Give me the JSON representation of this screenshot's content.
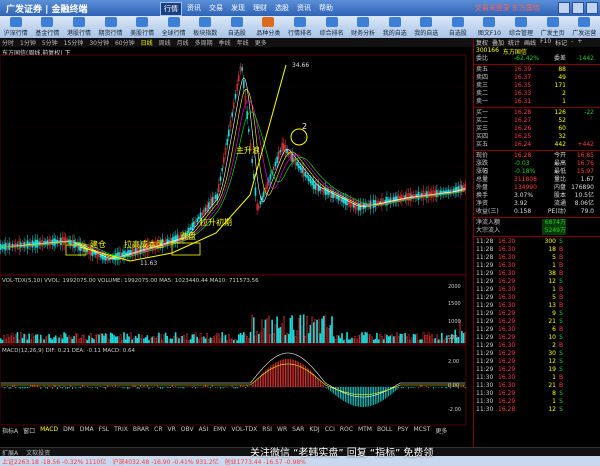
{
  "window": {
    "app_name": "广发证券 | 金融终端",
    "menu": [
      "行情",
      "资讯",
      "交易",
      "发现",
      "理财",
      "选股",
      "资讯",
      "帮助"
    ],
    "active_menu": 0,
    "top_right_text": "交易未登录   东方国信"
  },
  "toolbar": {
    "items": [
      "沪深行情",
      "基金行情",
      "港股行情",
      "期货行情",
      "美股行情",
      "全球行情",
      "板块指数",
      "自选股",
      "品种分类",
      "行情排名",
      "综合排名",
      "财务分析",
      "我的自选",
      "我的自选",
      "自选股",
      "图文F10",
      "综合管理",
      "广发主页",
      "广发运营"
    ]
  },
  "period_tabs": {
    "items": [
      "分时",
      "1分钟",
      "5分钟",
      "15分钟",
      "30分钟",
      "60分钟",
      "日线",
      "周线",
      "月线",
      "多周期",
      "季线",
      "年线",
      "更多"
    ],
    "active": 6
  },
  "chart_header": {
    "stock_title": "东方国信(周线,前复权) 下",
    "peak_label": "34.66",
    "low_label": "11.63"
  },
  "annotations": {
    "jian_cang": "建仓",
    "la_gao": "拉高成本区",
    "xi_pan": "洗盘",
    "la_sheng": "拉升初期",
    "zhu_sheng": "主升浪",
    "mark2": "2"
  },
  "vol_pane": {
    "label": "VOL-TDX(5,10) VVOL: 1992075.00  VOLUME: 1992075.00  MA5: 1023440.44  MA10: 711573.56",
    "ticks": [
      "2000",
      "1500",
      "1000",
      "500"
    ]
  },
  "macd_pane": {
    "label": "MACD(12,26,9) DIF: 0.21  DEA: -0.11  MACD: 0.64",
    "ticks": [
      "2.00",
      "0.00",
      "-2.00"
    ]
  },
  "indicator_tabs": {
    "items": [
      "指标A",
      "窗口",
      "MACD",
      "DMI",
      "DMA",
      "FSL",
      "TRIX",
      "BRAR",
      "CR",
      "VR",
      "OBV",
      "ASI",
      "EMV",
      "VOL-TDX",
      "RSI",
      "WR",
      "SAR",
      "KDJ",
      "CCI",
      "ROC",
      "MTM",
      "BOLL",
      "PSY",
      "MCST",
      "更多"
    ],
    "active": 2
  },
  "bottom_tabs": [
    "扩展A",
    "文软投资"
  ],
  "quote": {
    "header": [
      "复权",
      "叠加",
      "统计",
      "画线",
      "F10",
      "标记",
      "-",
      "+"
    ],
    "code": "300166",
    "name": "东方国信",
    "weibi": {
      "label": "委比",
      "value": "-62.42%",
      "label2": "委差",
      "value2": "-1442"
    },
    "sells": [
      {
        "name": "卖五",
        "price": "16.39",
        "vol": "88"
      },
      {
        "name": "卖四",
        "price": "16.37",
        "vol": "49"
      },
      {
        "name": "卖三",
        "price": "16.35",
        "vol": "171"
      },
      {
        "name": "卖二",
        "price": "16.33",
        "vol": "2"
      },
      {
        "name": "卖一",
        "price": "16.31",
        "vol": "1"
      }
    ],
    "buys": [
      {
        "name": "买一",
        "price": "16.28",
        "vol": "126",
        "chg": "-22"
      },
      {
        "name": "买二",
        "price": "16.27",
        "vol": "52",
        "chg": ""
      },
      {
        "name": "买三",
        "price": "16.26",
        "vol": "60",
        "chg": ""
      },
      {
        "name": "买四",
        "price": "16.25",
        "vol": "32",
        "chg": ""
      },
      {
        "name": "买五",
        "price": "16.24",
        "vol": "442",
        "chg": "+442"
      }
    ],
    "stats": [
      {
        "l1": "现价",
        "v1": "16.28",
        "l2": "今开",
        "v2": "16.85"
      },
      {
        "l1": "涨跌",
        "v1": "-0.03",
        "l2": "最高",
        "v2": "16.76"
      },
      {
        "l1": "涨幅",
        "v1": "-0.18%",
        "l2": "最低",
        "v2": "15.97"
      },
      {
        "l1": "总量",
        "v1": "311808",
        "l2": "量比",
        "v2": "1.67"
      },
      {
        "l1": "外盘",
        "v1": "134990",
        "l2": "内盘",
        "v2": "176890"
      },
      {
        "l1": "换手",
        "v1": "3.07%",
        "l2": "股本",
        "v2": "10.5亿"
      },
      {
        "l1": "净资",
        "v1": "3.92",
        "l2": "流通",
        "v2": "8.06亿"
      },
      {
        "l1": "收益(三)",
        "v1": "0.158",
        "l2": "PE(动)",
        "v2": "79.0"
      }
    ],
    "flows": [
      {
        "label": "净流入额",
        "value": "6874万"
      },
      {
        "label": "大宗流入",
        "value": "5249万"
      }
    ],
    "ticks": [
      {
        "t": "11:28",
        "p": "16.30",
        "v": "300",
        "s": "S"
      },
      {
        "t": "11:28",
        "p": "16.30",
        "v": "18",
        "s": "B"
      },
      {
        "t": "11:28",
        "p": "16.30",
        "v": "5",
        "s": "B"
      },
      {
        "t": "11:29",
        "p": "16.30",
        "v": "1",
        "s": "B"
      },
      {
        "t": "11:29",
        "p": "16.30",
        "v": "38",
        "s": "B"
      },
      {
        "t": "11:29",
        "p": "16.29",
        "v": "12",
        "s": "S"
      },
      {
        "t": "11:29",
        "p": "16.30",
        "v": "1",
        "s": "B"
      },
      {
        "t": "11:29",
        "p": "16.30",
        "v": "5",
        "s": "B"
      },
      {
        "t": "11:29",
        "p": "16.30",
        "v": "13",
        "s": "B"
      },
      {
        "t": "11:29",
        "p": "16.29",
        "v": "9",
        "s": "S"
      },
      {
        "t": "11:29",
        "p": "16.29",
        "v": "21",
        "s": "S"
      },
      {
        "t": "11:29",
        "p": "16.30",
        "v": "6",
        "s": "B"
      },
      {
        "t": "11:29",
        "p": "16.29",
        "v": "10",
        "s": "S"
      },
      {
        "t": "11:29",
        "p": "16.30",
        "v": "2",
        "s": "B"
      },
      {
        "t": "11:29",
        "p": "16.29",
        "v": "30",
        "s": "S"
      },
      {
        "t": "11:29",
        "p": "16.29",
        "v": "12",
        "s": "S"
      },
      {
        "t": "11:29",
        "p": "16.29",
        "v": "19",
        "s": "S"
      },
      {
        "t": "11:30",
        "p": "16.30",
        "v": "1",
        "s": "B"
      },
      {
        "t": "11:30",
        "p": "16.30",
        "v": "21",
        "s": "B"
      },
      {
        "t": "11:30",
        "p": "16.29",
        "v": "8",
        "s": "S"
      },
      {
        "t": "11:30",
        "p": "16.29",
        "v": "1",
        "s": "S"
      },
      {
        "t": "11:30",
        "p": "16.28",
        "v": "12",
        "s": "S"
      }
    ]
  },
  "statusbar": {
    "items": [
      "上证2263.18 -18.56 -0.32% 1110亿",
      "沪深4032.48 -16.90 -0.41% 931.2亿",
      "创业1773.44 -16.57 -0.98%"
    ]
  },
  "watermark": "关注微信 “老韩实盘” 回复 “指标” 免费领",
  "chart_data": {
    "type": "candlestick",
    "peak": 34.66,
    "low": 11.63
  }
}
